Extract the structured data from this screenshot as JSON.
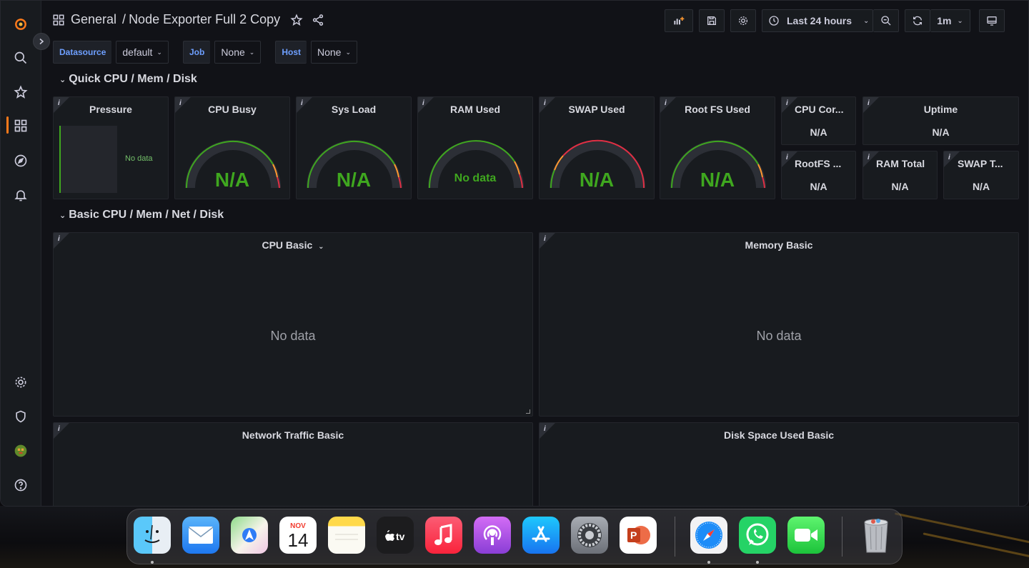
{
  "breadcrumb": {
    "folder": "General",
    "separator": "/",
    "title": "Node Exporter Full 2 Copy"
  },
  "toolbar": {
    "time_range": "Last 24 hours",
    "refresh_interval": "1m"
  },
  "variables": [
    {
      "label": "Datasource",
      "value": "default"
    },
    {
      "label": "Job",
      "value": "None"
    },
    {
      "label": "Host",
      "value": "None"
    }
  ],
  "rows": {
    "quick": "Quick CPU / Mem / Disk",
    "basic": "Basic CPU / Mem / Net / Disk"
  },
  "info_glyph": "i",
  "quick_panels": {
    "pressure": {
      "title": "Pressure",
      "value": "No data"
    },
    "cpu_busy": {
      "title": "CPU Busy",
      "value": "N/A"
    },
    "sys_load": {
      "title": "Sys Load",
      "value": "N/A"
    },
    "ram_used": {
      "title": "RAM Used",
      "value": "No data"
    },
    "swap_used": {
      "title": "SWAP Used",
      "value": "N/A"
    },
    "root_fs_used": {
      "title": "Root FS Used",
      "value": "N/A"
    },
    "cpu_cores": {
      "title": "CPU Cor...",
      "value": "N/A"
    },
    "uptime": {
      "title": "Uptime",
      "value": "N/A"
    },
    "rootfs_total": {
      "title": "RootFS ...",
      "value": "N/A"
    },
    "ram_total": {
      "title": "RAM Total",
      "value": "N/A"
    },
    "swap_total": {
      "title": "SWAP T...",
      "value": "N/A"
    }
  },
  "basic_panels": {
    "cpu_basic": {
      "title": "CPU Basic",
      "value": "No data"
    },
    "memory_basic": {
      "title": "Memory Basic",
      "value": "No data"
    },
    "network_basic": {
      "title": "Network Traffic Basic"
    },
    "disk_basic": {
      "title": "Disk Space Used Basic"
    }
  },
  "calendar": {
    "month": "NOV",
    "day": "14"
  },
  "colors": {
    "accent": "#ff7a1a",
    "gauge_green": "#3fa71f",
    "gauge_red": "#e02f44",
    "gauge_orange": "#ff9830",
    "link_blue": "#6e9fff"
  },
  "dock_apps": [
    "Finder",
    "Mail",
    "Maps",
    "Calendar",
    "Notes",
    "TV",
    "Music",
    "Podcasts",
    "App Store",
    "System Preferences",
    "PowerPoint",
    "Safari",
    "WhatsApp",
    "FaceTime",
    "Trash"
  ]
}
